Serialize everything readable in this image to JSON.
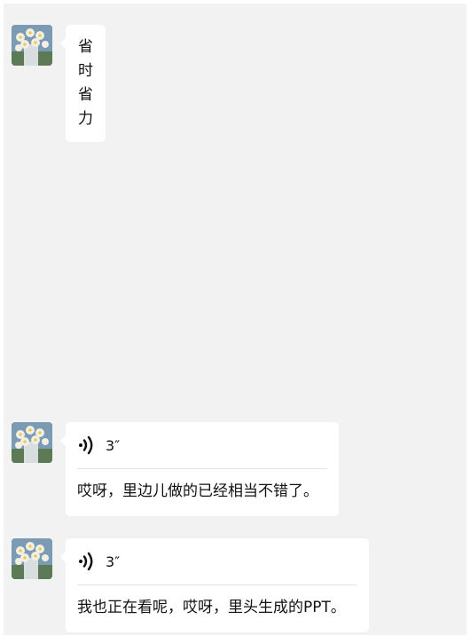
{
  "messages": [
    {
      "type": "text",
      "text": "省时省力"
    },
    {
      "type": "voice",
      "duration": "3″",
      "transcript": "哎呀，里边儿做的已经相当不错了。"
    },
    {
      "type": "voice",
      "duration": "3″",
      "transcript": "我也正在看呢，哎呀，里头生成的PPT。"
    }
  ],
  "colors": {
    "chat_background": "#f2f2f2",
    "bubble": "#ffffff",
    "divider": "#e3e3e3"
  }
}
